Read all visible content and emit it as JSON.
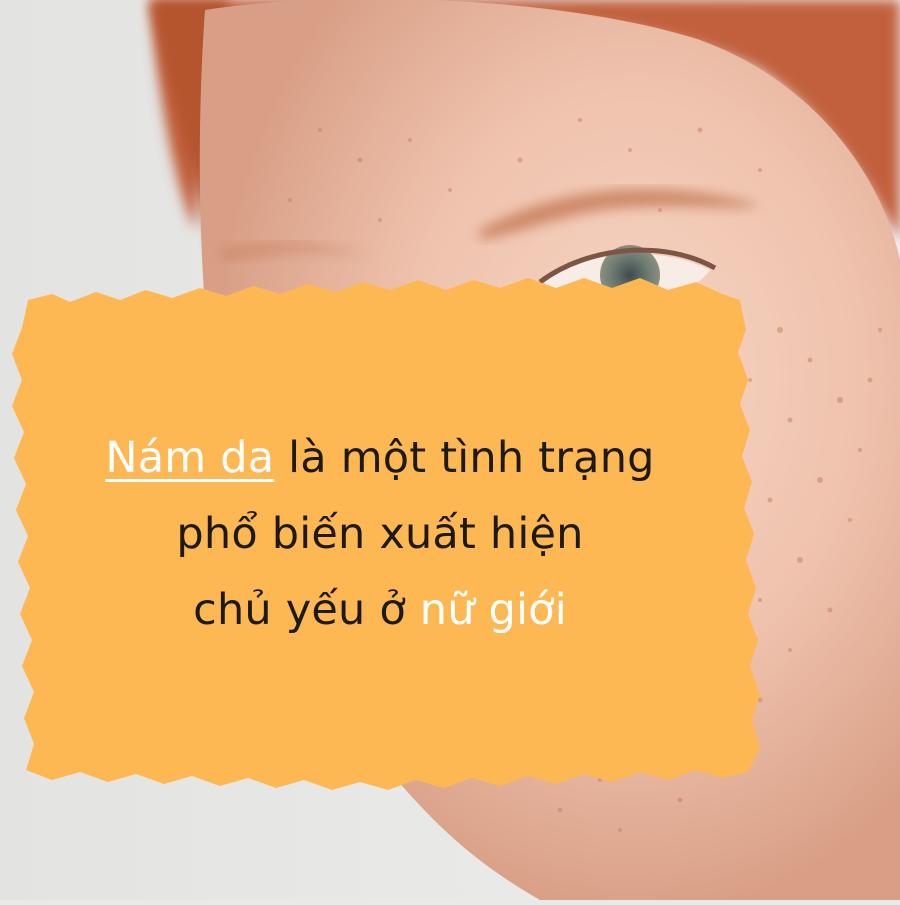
{
  "caption": {
    "highlight_1": "Nám da",
    "line_1_rest": " là một tình trạng",
    "line_2": "phổ biến xuất hiện",
    "line_3_start": "chủ yếu ở ",
    "highlight_2": "nữ giới"
  },
  "colors": {
    "paper": "#fdb853",
    "text": "#1d1a14",
    "highlight": "#ffffff",
    "background": "#e9e9e8",
    "skin": "#f1c8b4",
    "freckles": "#c98466",
    "hair": "#c2603c"
  },
  "icons": [
    "torn-paper-note"
  ]
}
